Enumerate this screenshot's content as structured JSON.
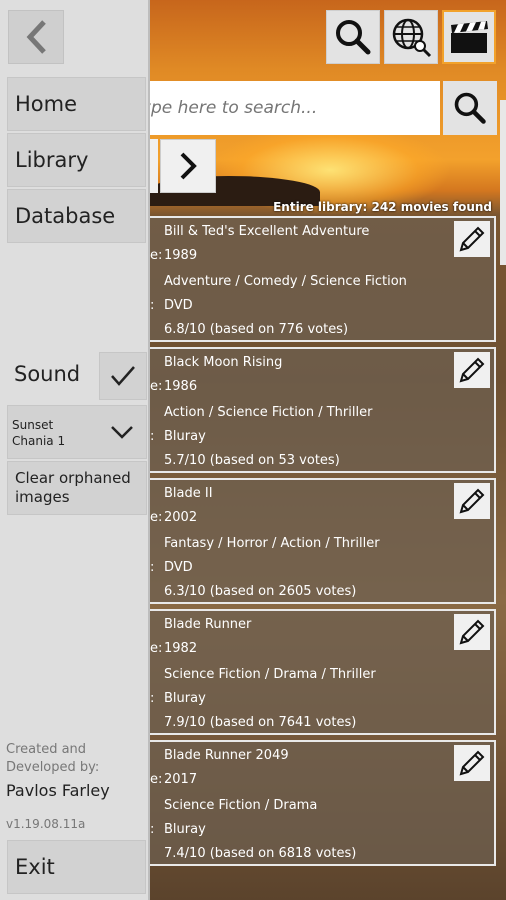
{
  "topbar": {
    "icons": [
      "search-icon",
      "globe-icon",
      "clapperboard-icon"
    ],
    "active_color": "#f2a22b"
  },
  "search": {
    "placeholder": "Type here to search..."
  },
  "results": {
    "count_text": "Entire library: 242 movies found"
  },
  "movies": [
    {
      "title": "Bill & Ted's Excellent Adventure",
      "year_prefix": "e:",
      "year": "1989",
      "genres": "Adventure / Comedy / Science Fiction",
      "media_prefix": ":",
      "media": "DVD",
      "rating": "6.8/10 (based on 776 votes)"
    },
    {
      "title": "Black Moon Rising",
      "year_prefix": "e:",
      "year": "1986",
      "genres": "Action / Science Fiction / Thriller",
      "media_prefix": ":",
      "media": "Bluray",
      "rating": "5.7/10 (based on 53 votes)"
    },
    {
      "title": "Blade II",
      "year_prefix": "e:",
      "year": "2002",
      "genres": "Fantasy / Horror / Action / Thriller",
      "media_prefix": ":",
      "media": "DVD",
      "rating": "6.3/10 (based on 2605 votes)"
    },
    {
      "title": "Blade Runner",
      "year_prefix": "e:",
      "year": "1982",
      "genres": "Science Fiction / Drama / Thriller",
      "media_prefix": ":",
      "media": "Bluray",
      "rating": "7.9/10 (based on 7641 votes)"
    },
    {
      "title": "Blade Runner 2049",
      "year_prefix": "e:",
      "year": "2017",
      "genres": "Science Fiction / Drama",
      "media_prefix": ":",
      "media": "Bluray",
      "rating": "7.4/10 (based on 6818 votes)"
    }
  ],
  "drawer": {
    "menu": [
      {
        "label": "Home"
      },
      {
        "label": "Library"
      },
      {
        "label": "Database"
      }
    ],
    "sound_label": "Sound",
    "sound_checked": true,
    "theme": {
      "line1": "Sunset",
      "line2": "Chania 1"
    },
    "clear_label_1": "Clear orphaned",
    "clear_label_2": "images",
    "credits_1": "Created and",
    "credits_2": "Developed by:",
    "author": "Pavlos Farley",
    "version": "v1.19.08.11a",
    "exit_label": "Exit"
  }
}
